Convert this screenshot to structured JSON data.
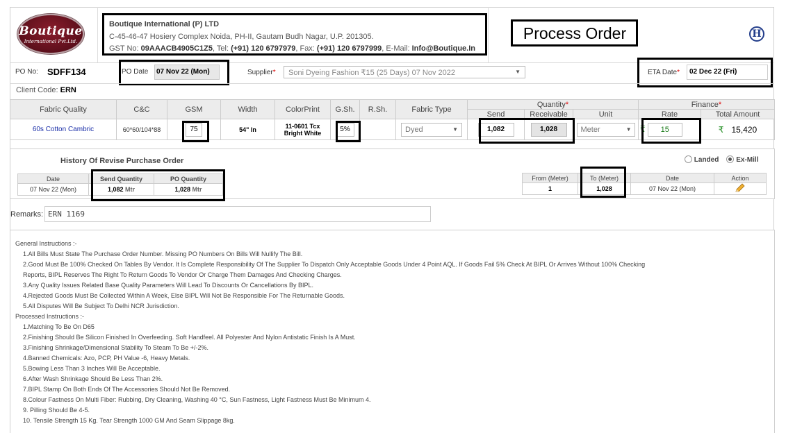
{
  "header": {
    "logo_top": "Boutique",
    "logo_bottom": "International Pvt.Ltd.",
    "company_name": "Boutique International (P) LTD",
    "address": "C-45-46-47 Hosiery Complex Noida, PH-II, Gautam Budh Nagar, U.P. 201305.",
    "gst_label": "GST No: ",
    "gst_value": "09AAACB4905C1Z5",
    "tel_label": ", Tel: ",
    "tel_value": "(+91) 120 6797979",
    "fax_label": ", Fax: ",
    "fax_value": "(+91) 120 6797999",
    "email_label": ", E-Mail: ",
    "email_value": "Info@Boutique.In",
    "page_title": "Process Order",
    "h_icon": "H"
  },
  "order": {
    "po_no_label": "PO No:",
    "po_no": "SDFF134",
    "po_date_label": "PO Date",
    "po_date": "07 Nov 22 (Mon)",
    "supplier_label": "Supplier",
    "supplier_value": "Soni Dyeing Fashion ₹15 (25 Days) 07 Nov 2022",
    "eta_label": "ETA Date",
    "eta_value": "02 Dec 22 (Fri)",
    "client_code_label": "Client Code:",
    "client_code": "ERN",
    "required_mark": "*"
  },
  "fabric_table": {
    "headers": {
      "fabric_quality": "Fabric Quality",
      "cc": "C&C",
      "gsm": "GSM",
      "width": "Width",
      "colorprint": "ColorPrint",
      "gsh": "G.Sh.",
      "rsh": "R.Sh.",
      "fabric_type": "Fabric Type",
      "quantity": "Quantity",
      "send": "Send",
      "receivable": "Receivable",
      "unit": "Unit",
      "finance": "Finance",
      "rate": "Rate",
      "total_amount": "Total Amount"
    },
    "row": {
      "fabric_quality": "60s Cotton Cambric",
      "cc": "60*60/104*88",
      "gsm": "75",
      "width": "54\" In",
      "colorprint_line1": "11-0601 Tcx",
      "colorprint_line2": "Bright White",
      "gsh": "5%",
      "rsh": "",
      "fabric_type": "Dyed",
      "send": "1,082",
      "receivable": "1,028",
      "unit": "Meter",
      "currency": "₹",
      "rate": "15",
      "total_amount": "15,420"
    }
  },
  "history": {
    "title": "History Of Revise Purchase Order",
    "headers": {
      "date": "Date",
      "send_qty": "Send Quantity",
      "po_qty": "PO Quantity"
    },
    "row": {
      "date": "07 Nov 22 (Mon)",
      "send_qty": "1,082",
      "send_unit": "Mtr",
      "po_qty": "1,028",
      "po_unit": "Mtr"
    },
    "landed_label": "Landed",
    "exmill_label": "Ex-Mill",
    "range_headers": {
      "from": "From (Meter)",
      "to": "To (Meter)",
      "date": "Date",
      "action": "Action"
    },
    "range_row": {
      "from": "1",
      "to": "1,028",
      "date": "07 Nov 22 (Mon)"
    }
  },
  "remarks": {
    "label": "Remarks:",
    "value": "ERN 1169"
  },
  "instructions": {
    "general_title": "General Instructions :-",
    "general": [
      "1.All Bills Must State The Purchase Order Number. Missing PO Numbers On Bills Will Nullify The Bill.",
      "2.Good Must Be 100% Checked On Tables By Vendor. It Is Complete Responsibility Of The Supplier To Dispatch Only Acceptable Goods Under 4 Point AQL. If Goods Fail 5% Check At BIPL Or Arrives Without 100% Checking",
      "Reports, BIPL Reserves The Right To Return Goods To Vendor Or Charge Them Damages And Checking Charges.",
      "3.Any Quality Issues Related Base Quality Parameters Will Lead To Discounts Or Cancellations By BIPL.",
      "4.Rejected Goods Must Be Collected Within A Week, Else BIPL Will Not Be Responsible For The Returnable Goods.",
      "5.All Disputes Will Be Subject To Delhi NCR Jurisdiction."
    ],
    "processed_title": "Processed Instructions :-",
    "processed": [
      "1.Matching To Be On D65",
      "2.Finishing Should Be Silicon Finished In Overfeeding. Soft Handfeel. All Polyester And Nylon Antistatic Finish Is A Must.",
      "3.Finishing Shrinkage/Dimensional Stability To Steam To Be +/-2%.",
      "4.Banned Chemicals: Azo, PCP, PH Value -6, Heavy Metals.",
      "5.Bowing Less Than 3 Inches Will Be Acceptable.",
      "6.After Wash Shrinkage Should Be Less Than 2%.",
      "7.BIPL Stamp On Both Ends Of The Accessories Should Not Be Removed.",
      "8.Colour Fastness On Multi Fiber: Rubbing, Dry Cleaning, Washing 40 °C, Sun Fastness, Light Fastness Must Be Minimum 4.",
      "9. Pilling Should Be 4-5.",
      "10. Tensile Strength 15 Kg. Tear Strength 1000 GM And Seam Slippage 8kg."
    ]
  }
}
